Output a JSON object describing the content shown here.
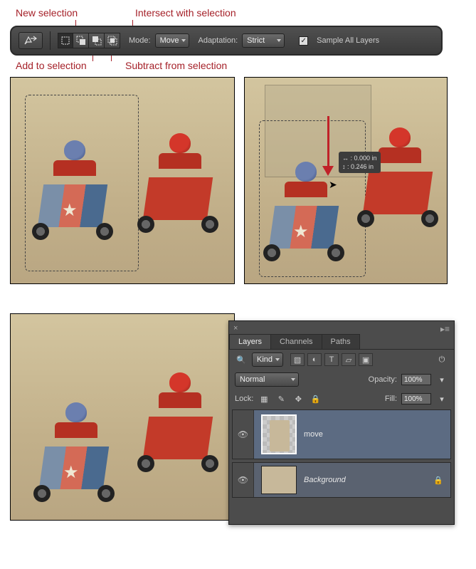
{
  "callouts": {
    "new_selection": "New selection",
    "intersect": "Intersect with selection",
    "add": "Add to selection",
    "subtract": "Subtract from selection"
  },
  "options_bar": {
    "mode_label": "Mode:",
    "mode_value": "Move",
    "adaptation_label": "Adaptation:",
    "adaptation_value": "Strict",
    "sample_all_layers": "Sample All Layers",
    "sample_checked": "✓"
  },
  "selection_buttons": {
    "new": "New selection",
    "add": "Add to selection",
    "subtract": "Subtract from selection",
    "intersect": "Intersect with selection"
  },
  "move_tooltip": {
    "horiz_label": "↔ :",
    "horiz_value": "0.000 in",
    "vert_label": "↕ :",
    "vert_value": "0.246 in"
  },
  "layers_panel": {
    "tabs": {
      "layers": "Layers",
      "channels": "Channels",
      "paths": "Paths"
    },
    "filter_kind": "Kind",
    "blend_mode": "Normal",
    "opacity_label": "Opacity:",
    "opacity_value": "100%",
    "lock_label": "Lock:",
    "fill_label": "Fill:",
    "fill_value": "100%",
    "layers": [
      {
        "name": "move",
        "selected": true
      },
      {
        "name": "Background",
        "selected": false
      }
    ]
  }
}
